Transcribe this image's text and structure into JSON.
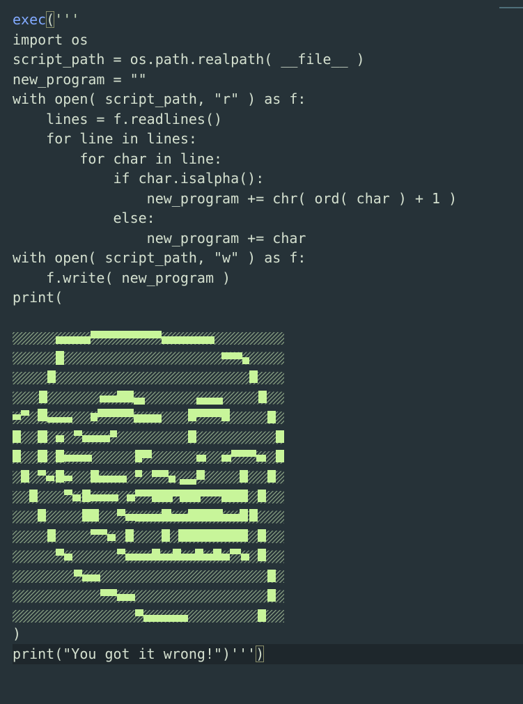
{
  "editor": {
    "code_lines": [
      "exec('''",
      "import os",
      "script_path = os.path.realpath( __file__ )",
      "new_program = \"\"",
      "with open( script_path, \"r\" ) as f:",
      "    lines = f.readlines()",
      "    for line in lines:",
      "        for char in line:",
      "            if char.isalpha():",
      "                new_program += chr( ord( char ) + 1 )",
      "            else:",
      "                new_program += char",
      "with open( script_path, \"w\" ) as f:",
      "    f.write( new_program )",
      "print("
    ],
    "closing_paren": ")",
    "final_line": "print(\"You got it wrong!\")''')"
  },
  "colors": {
    "background": "#263238",
    "text": "#d4e0cf",
    "keyword": "#82aaff",
    "block_fill": "#c8f59a",
    "hatch": "#8fa888",
    "current_line": "#1e272c"
  },
  "art": {
    "description_icon": "ascii-block-art-face"
  }
}
